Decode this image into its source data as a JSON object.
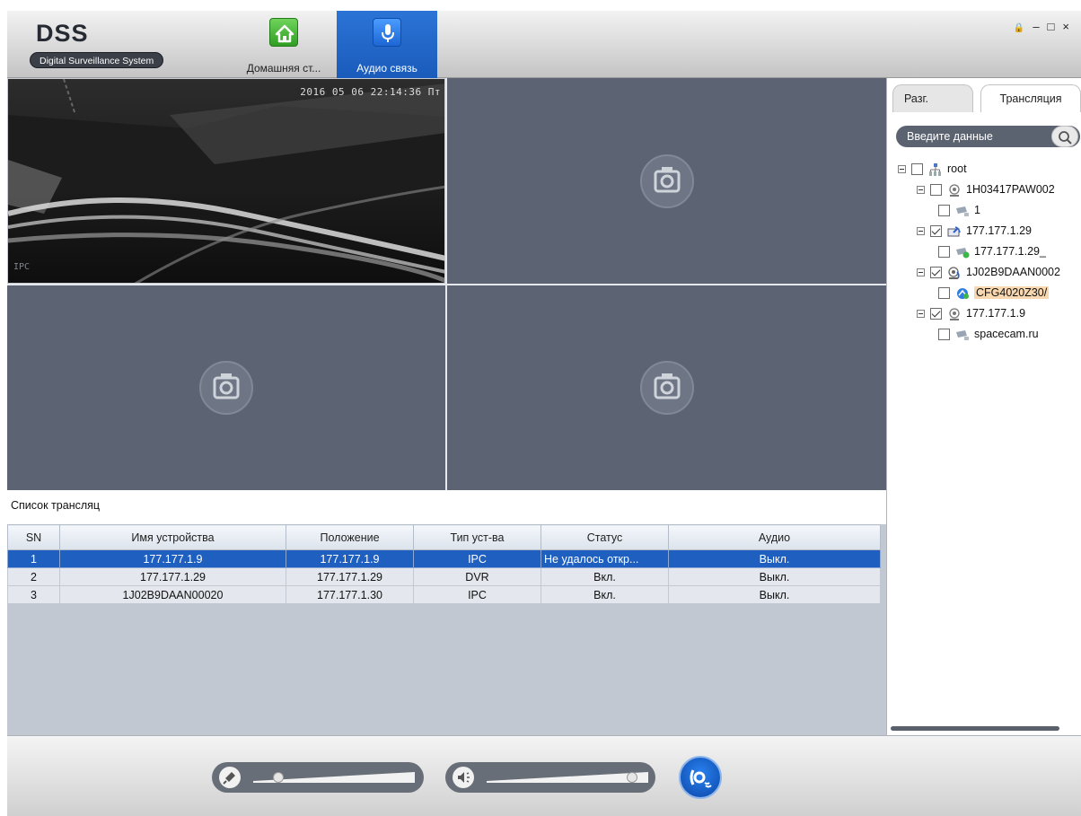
{
  "app": {
    "logo": "DSS",
    "logo_subtitle": "Digital Surveillance System"
  },
  "nav": {
    "home_label": "Домашняя ст...",
    "audio_label": "Аудио связь"
  },
  "window_controls": {
    "lock": "🔒",
    "minimize": "–",
    "maximize": "□",
    "close": "×"
  },
  "video": {
    "osd_time": "2016 05 06 22:14:36 Пт",
    "osd_channel": "IPC"
  },
  "broadcast_list": {
    "title": "Список трансляц",
    "columns": [
      "SN",
      "Имя устройства",
      "Положение",
      "Тип уст-ва",
      "Статус",
      "Аудио"
    ],
    "rows": [
      {
        "sn": "1",
        "name": "177.177.1.9",
        "location": "177.177.1.9",
        "type": "IPC",
        "status": "Не удалось откр...",
        "audio": "Выкл.",
        "selected": true
      },
      {
        "sn": "2",
        "name": "177.177.1.29",
        "location": "177.177.1.29",
        "type": "DVR",
        "status": "Вкл.",
        "audio": "Выкл.",
        "selected": false
      },
      {
        "sn": "3",
        "name": "1J02B9DAAN00020",
        "location": "177.177.1.30",
        "type": "IPC",
        "status": "Вкл.",
        "audio": "Выкл.",
        "selected": false
      }
    ]
  },
  "right_panel": {
    "tab_talk": "Разг.",
    "tab_broadcast": "Трансляция",
    "search_placeholder": "Введите данные",
    "tree": {
      "root": "root",
      "dev1": "1H03417PAW002",
      "dev1_ch1": "1",
      "dev2": "177.177.1.29",
      "dev2_ch1": "177.177.1.29_",
      "dev3": "1J02B9DAAN0002",
      "dev3_ch1": "CFG4020Z30/",
      "dev4": "177.177.1.9",
      "dev4_ch1": "spacecam.ru"
    }
  },
  "colors": {
    "accent": "#1f5fc0",
    "video_empty": "#5c6474",
    "panel_bg": "#c2c8d2"
  }
}
